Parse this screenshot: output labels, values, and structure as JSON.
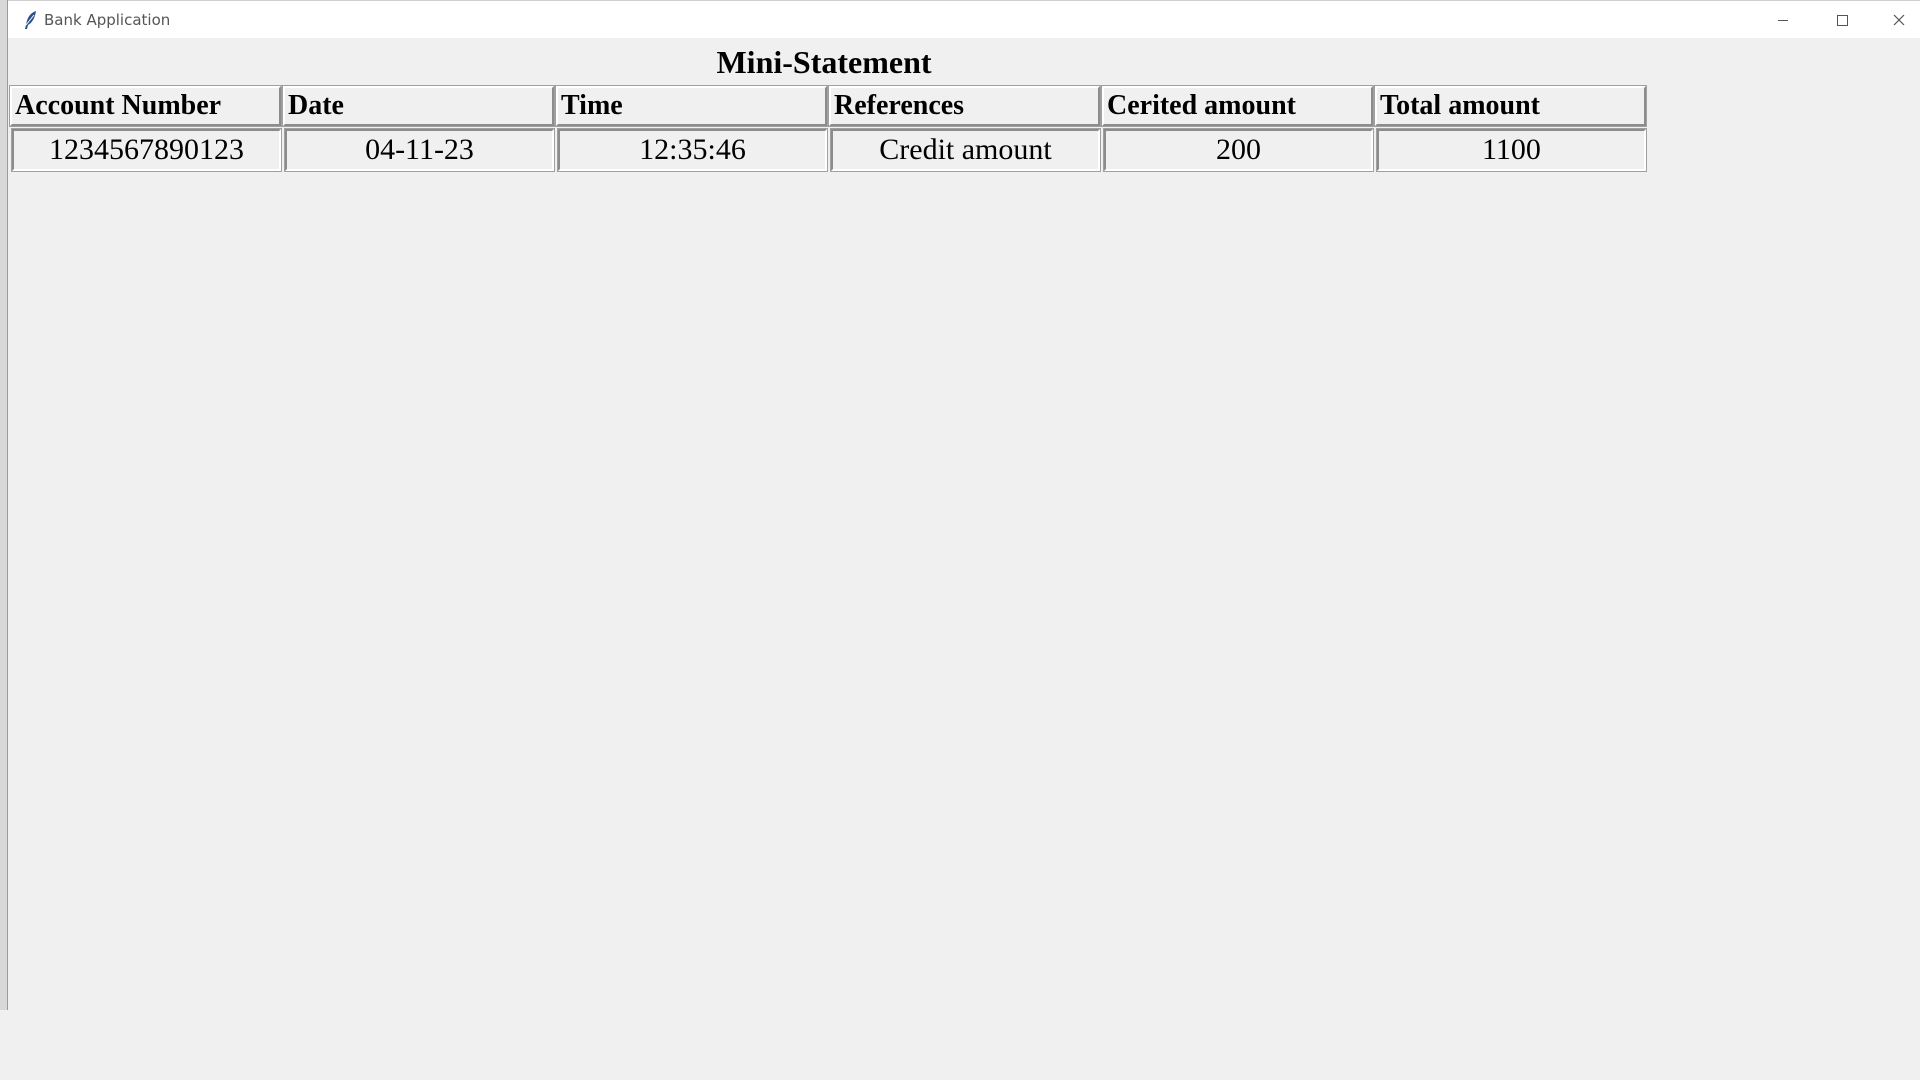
{
  "window": {
    "title": "Bank Application"
  },
  "statement": {
    "heading": "Mini-Statement",
    "columns": [
      "Account Number",
      "Date",
      "Time",
      "References",
      "Cerited amount",
      "Total amount"
    ],
    "rows": [
      [
        "1234567890123",
        "04-11-23",
        "12:35:46",
        "Credit amount",
        "200",
        "1100"
      ]
    ]
  }
}
